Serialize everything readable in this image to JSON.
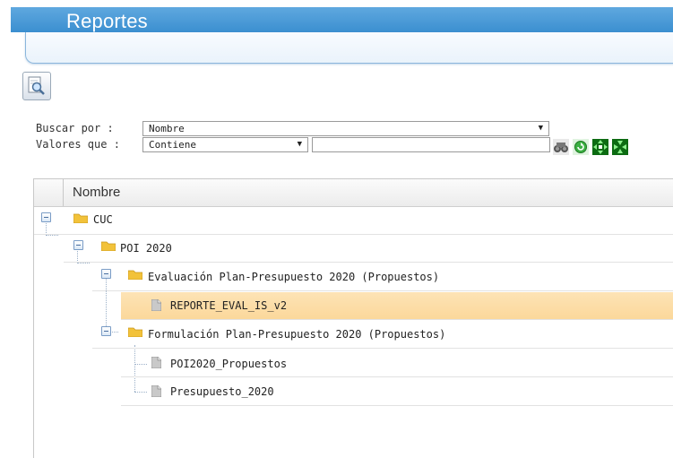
{
  "header": {
    "title": "Reportes"
  },
  "toolbar": {
    "search_icon": "magnifier-page-icon"
  },
  "filters": {
    "buscar_label": "Buscar por :",
    "buscar_value": "Nombre",
    "valores_label": "Valores que :",
    "valores_value": "Contiene",
    "search_text": "",
    "arrow": "▼"
  },
  "tools": [
    "binoculars-icon",
    "refresh-icon",
    "expand-all-icon",
    "collapse-all-icon"
  ],
  "grid": {
    "column": "Nombre",
    "nodes": [
      {
        "label": "CUC",
        "type": "folder",
        "level": 0,
        "expanded": true
      },
      {
        "label": "POI 2020",
        "type": "folder",
        "level": 1,
        "expanded": true
      },
      {
        "label": "Evaluación Plan-Presupuesto 2020 (Propuestos)",
        "type": "folder",
        "level": 2,
        "expanded": true
      },
      {
        "label": "REPORTE_EVAL_IS_v2",
        "type": "report",
        "level": 3,
        "selected": true
      },
      {
        "label": "Formulación Plan-Presupuesto 2020 (Propuestos)",
        "type": "folder",
        "level": 2,
        "expanded": true
      },
      {
        "label": "POI2020_Propuestos",
        "type": "report",
        "level": 3
      },
      {
        "label": "Presupuesto_2020",
        "type": "report",
        "level": 3
      }
    ]
  },
  "colors": {
    "header": "#3b8fd0",
    "selected_row": "#fbd89b",
    "folder": "#f2c23a"
  }
}
